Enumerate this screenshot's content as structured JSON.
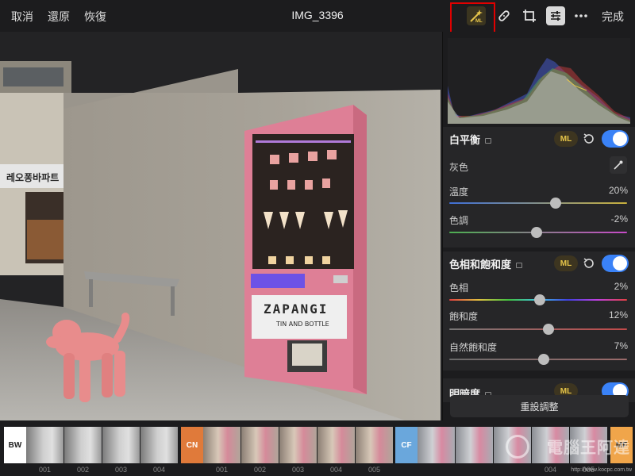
{
  "topbar": {
    "cancel": "取消",
    "revert": "還原",
    "redo": "恢復",
    "title": "IMG_3396",
    "done": "完成",
    "ml_icon_text": "ML"
  },
  "photo": {
    "brand": "ZAPANGI",
    "brand_sub": "TIN AND BOTTLE",
    "shop_sign": "레오퐁바파트"
  },
  "panel": {
    "white_balance": {
      "title": "白平衡",
      "ml": "ML",
      "gray_label": "灰色",
      "rows": [
        {
          "label": "溫度",
          "value": "20%",
          "level": 0.6
        },
        {
          "label": "色調",
          "value": "-2%",
          "level": 0.49
        }
      ]
    },
    "hue_saturation": {
      "title": "色相和飽和度",
      "ml": "ML",
      "rows": [
        {
          "label": "色相",
          "value": "2%",
          "level": 0.51
        },
        {
          "label": "飽和度",
          "value": "12%",
          "level": 0.56
        },
        {
          "label": "自然飽和度",
          "value": "7%",
          "level": 0.53
        }
      ]
    },
    "light": {
      "title": "明暗度",
      "ml": "ML"
    },
    "reset_all": "重設調整"
  },
  "filmstrip": {
    "categories": [
      "BW",
      "CN",
      "CF",
      "MF"
    ],
    "labels_bw": [
      "001",
      "002",
      "003",
      "004"
    ],
    "labels_cn": [
      "001",
      "002",
      "003",
      "004",
      "005"
    ],
    "labels_cf": [
      "004",
      "005"
    ]
  },
  "watermark": {
    "text": "電腦王阿達",
    "url": "http://www.kocpc.com.tw"
  },
  "colors": {
    "accent": "#3a82f7",
    "ml_gold": "#e6c54a",
    "highlight": "#e10000",
    "bw_tile": "#ffffff",
    "cn_tile": "#e07a3a",
    "cf_tile": "#6aa7dc",
    "mf_tile": "#f0a54a"
  }
}
